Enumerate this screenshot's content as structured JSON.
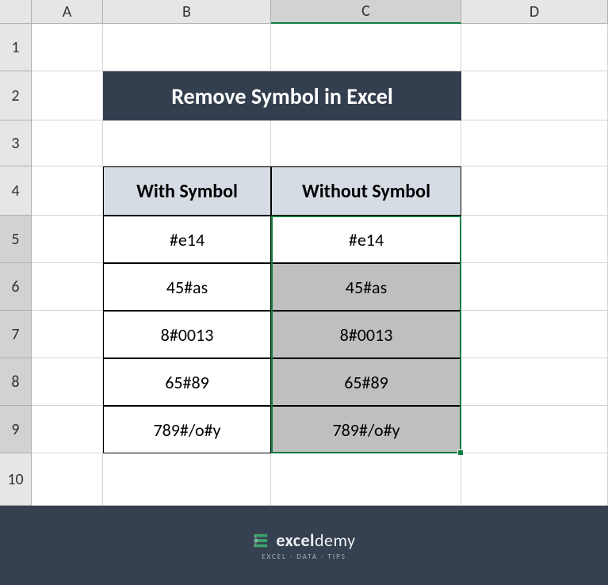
{
  "columns": [
    "A",
    "B",
    "C",
    "D"
  ],
  "rows": [
    "1",
    "2",
    "3",
    "4",
    "5",
    "6",
    "7",
    "8",
    "9",
    "10"
  ],
  "title": "Remove Symbol in Excel",
  "table": {
    "headers": {
      "with": "With Symbol",
      "without": "Without Symbol"
    },
    "rows": [
      {
        "with": "#e14",
        "without": "#e14"
      },
      {
        "with": "45#as",
        "without": "45#as"
      },
      {
        "with": "8#0013",
        "without": "8#0013"
      },
      {
        "with": "65#89",
        "without": "65#89"
      },
      {
        "with": "789#/o#y",
        "without": "789#/o#y"
      }
    ]
  },
  "selection": {
    "range": "C5:C9"
  },
  "footer": {
    "brand_strong": "excel",
    "brand_light": "demy",
    "tagline": "EXCEL · DATA · TIPS"
  },
  "chart_data": {
    "type": "table",
    "title": "Remove Symbol in Excel",
    "columns": [
      "With Symbol",
      "Without Symbol"
    ],
    "rows": [
      [
        "#e14",
        "#e14"
      ],
      [
        "45#as",
        "45#as"
      ],
      [
        "8#0013",
        "8#0013"
      ],
      [
        "65#89",
        "65#89"
      ],
      [
        "789#/o#y",
        "789#/o#y"
      ]
    ]
  }
}
